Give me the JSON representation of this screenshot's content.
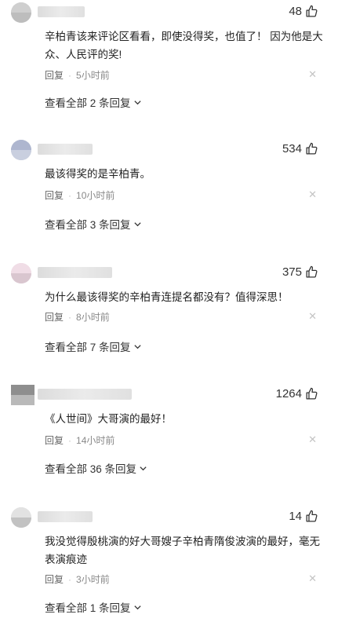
{
  "comments": [
    {
      "likes": "48",
      "text": "辛柏青该来评论区看看，即使没得奖，也值了！ 因为他是大众、人民评的奖!",
      "reply": "回复",
      "time": "5小时前",
      "view_all": "查看全部 2 条回复"
    },
    {
      "likes": "534",
      "text": "最该得奖的是辛柏青。",
      "reply": "回复",
      "time": "10小时前",
      "view_all": "查看全部 3 条回复"
    },
    {
      "likes": "375",
      "text": "为什么最该得奖的辛柏青连提名都没有？值得深思！",
      "reply": "回复",
      "time": "8小时前",
      "view_all": "查看全部 7 条回复"
    },
    {
      "likes": "1264",
      "text": "《人世间》大哥演的最好！",
      "reply": "回复",
      "time": "14小时前",
      "view_all": "查看全部 36 条回复"
    },
    {
      "likes": "14",
      "text": "我没觉得殷桃演的好大哥嫂子辛柏青隋俊波演的最好，毫无表演痕迹",
      "reply": "回复",
      "time": "3小时前",
      "view_all": "查看全部 1 条回复"
    }
  ],
  "icons": {
    "like": "thumbs-up-icon",
    "close": "close-icon",
    "expand": "chevron-down-icon"
  }
}
